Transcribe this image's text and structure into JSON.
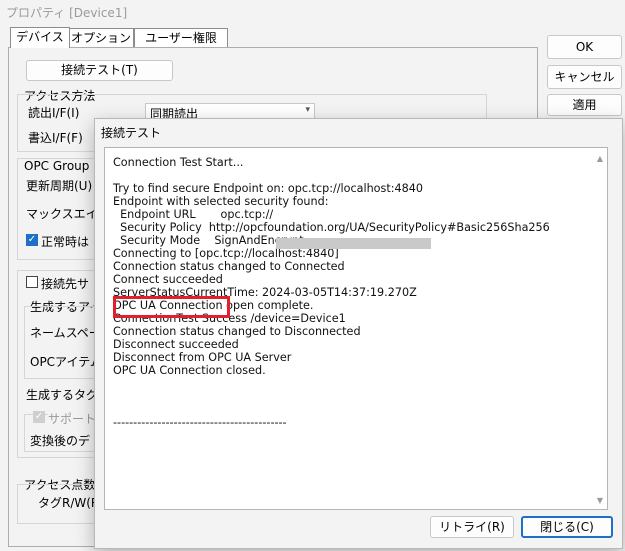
{
  "window": {
    "title": "プロパティ [Device1]"
  },
  "tabs": [
    {
      "label": "デバイス"
    },
    {
      "label": "オプション"
    },
    {
      "label": "ユーザー権限"
    }
  ],
  "side_buttons": {
    "ok": "OK",
    "cancel": "キャンセル",
    "apply": "適用"
  },
  "device_tab": {
    "connect_test_button": "接続テスト(T)",
    "access_method_label": "アクセス方法",
    "read_if_label": "読出I/F(I)",
    "read_if_value": "同期読出",
    "write_if_label": "書込I/F(F)",
    "opc_group_label": "OPC Group",
    "update_period_label": "更新周期(U)",
    "max_age_label": "マックスエイジ",
    "normal_label": "正常時は",
    "connect_target_label": "接続先サ",
    "generate_label_1": "生成するアイ",
    "namespace_label": "ネームスペー",
    "opc_item_label": "OPCアイテム",
    "generate_tag_label": "生成するタグの",
    "support_label": "サポート",
    "converted_label": "変換後のデ",
    "access_points_label": "アクセス点数",
    "tag_rw_label": "タグR/W(R"
  },
  "dialog": {
    "title": "接続テスト",
    "log_text": "Connection Test Start...\n\nTry to find secure Endpoint on: opc.tcp://localhost:4840\nEndpoint with selected security found:\n  Endpoint URL       opc.tcp://\n  Security Policy  http://opcfoundation.org/UA/SecurityPolicy#Basic256Sha256\n  Security Mode    SignAndEncrypt\nConnecting to [opc.tcp://localhost:4840]\nConnection status changed to Connected\nConnect succeeded\nServerStatusCurrentTime: 2024-03-05T14:37:19.270Z\nOPC UA Connection open complete.\nConnectionTest Success /device=Device1\nConnection status changed to Disconnected\nDisconnect succeeded\nDisconnect from OPC UA Server\nOPC UA Connection closed.\n\n\n\n-------------------------------------------",
    "retry_button": "リトライ(R)",
    "close_button": "閉じる(C)"
  }
}
